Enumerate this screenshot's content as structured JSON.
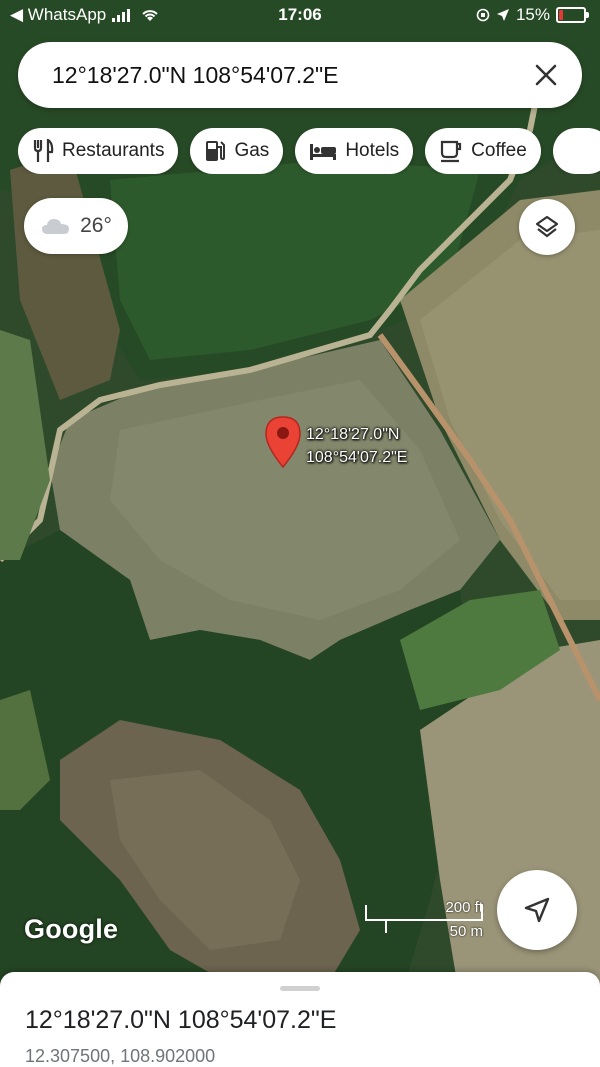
{
  "status_bar": {
    "back_app": "◀ WhatsApp",
    "time": "17:06",
    "battery": "15%"
  },
  "search": {
    "value": "12°18'27.0\"N 108°54'07.2\"E"
  },
  "chips": [
    {
      "label": "Restaurants",
      "icon": "utensils-icon"
    },
    {
      "label": "Gas",
      "icon": "gas-pump-icon"
    },
    {
      "label": "Hotels",
      "icon": "bed-icon"
    },
    {
      "label": "Coffee",
      "icon": "coffee-cup-icon"
    }
  ],
  "weather": {
    "temp": "26°",
    "icon": "cloud-icon"
  },
  "pin": {
    "line1": "12°18'27.0\"N",
    "line2": "108°54'07.2\"E",
    "color": "#ea4335"
  },
  "map": {
    "attribution": "Google",
    "scale_ft": "200 ft",
    "scale_m": "50 m"
  },
  "sheet": {
    "title": "12°18'27.0\"N 108°54'07.2\"E",
    "coords": "12.307500, 108.902000"
  }
}
